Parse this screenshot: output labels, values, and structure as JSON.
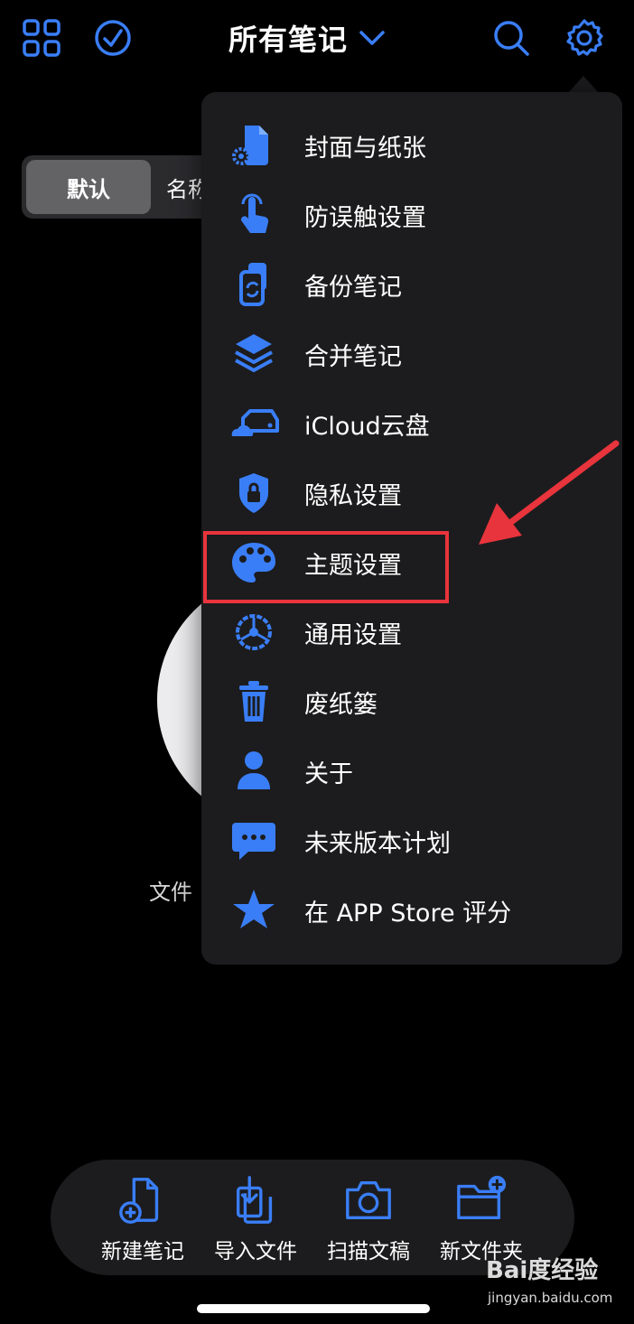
{
  "colors": {
    "accent": "#3a7ef7",
    "background": "#000000",
    "menu_background": "#1c1c1e",
    "highlight_red": "#e8343c"
  },
  "header": {
    "title": "所有笔记",
    "icons": [
      "grid-icon",
      "check-circle-icon",
      "chevron-down-icon",
      "search-icon",
      "gear-icon"
    ]
  },
  "segmented": {
    "default_label": "默认",
    "name_label": "名称"
  },
  "empty_state": {
    "text": "文件"
  },
  "menu": {
    "items": [
      {
        "label": "封面与纸张",
        "icon": "page-gear-icon"
      },
      {
        "label": "防误触设置",
        "icon": "hand-tap-icon"
      },
      {
        "label": "备份笔记",
        "icon": "backup-icon"
      },
      {
        "label": "合并笔记",
        "icon": "layers-icon"
      },
      {
        "label": "iCloud云盘",
        "icon": "icloud-drive-icon"
      },
      {
        "label": "隐私设置",
        "icon": "shield-lock-icon"
      },
      {
        "label": "主题设置",
        "icon": "palette-icon"
      },
      {
        "label": "通用设置",
        "icon": "steering-gear-icon"
      },
      {
        "label": "废纸篓",
        "icon": "trash-icon"
      },
      {
        "label": "关于",
        "icon": "person-icon"
      },
      {
        "label": "未来版本计划",
        "icon": "chat-bubble-icon"
      },
      {
        "label": "在 APP Store 评分",
        "icon": "star-icon"
      }
    ]
  },
  "toolbar": {
    "items": [
      {
        "label": "新建笔记",
        "icon": "new-note-icon"
      },
      {
        "label": "导入文件",
        "icon": "import-icon"
      },
      {
        "label": "扫描文稿",
        "icon": "camera-icon"
      },
      {
        "label": "新文件夹",
        "icon": "new-folder-icon"
      }
    ]
  },
  "watermark": {
    "brand": "Bai度经验",
    "url": "jingyan.baidu.com"
  }
}
